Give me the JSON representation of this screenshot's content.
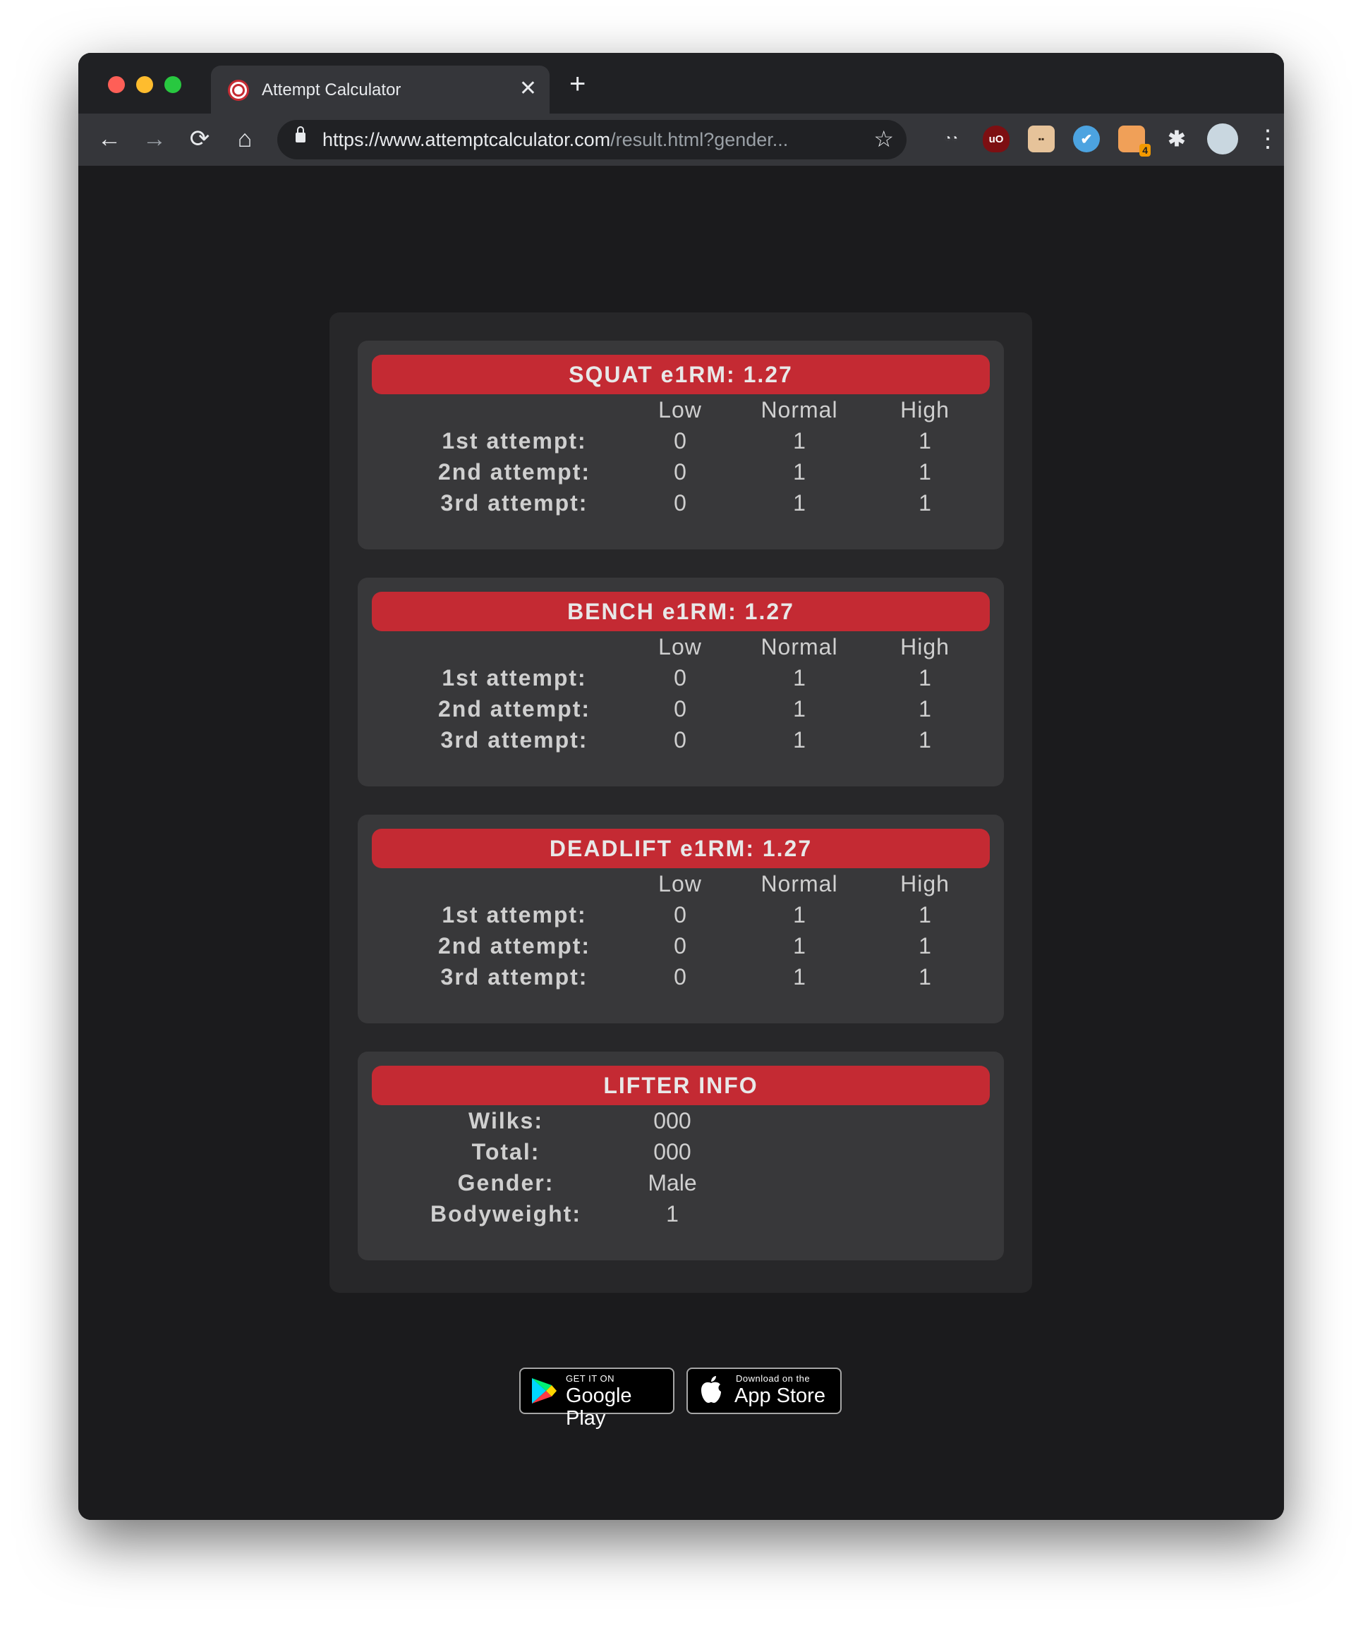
{
  "browser": {
    "tab_title": "Attempt Calculator",
    "tab_close": "✕",
    "new_tab": "+",
    "url_main": "https://www.attemptcalculator.com",
    "url_rest": "/result.html?gender...",
    "back": "←",
    "forward": "→",
    "reload": "⟳",
    "home": "⌂",
    "star": "☆",
    "menu": "⋮",
    "extensions": {
      "ext1": "◔◔",
      "ext2": "uO",
      "ext3": "▪▪",
      "ext4": "✔",
      "ext5_badge": "4",
      "puzzle": "✱"
    }
  },
  "cards": [
    {
      "title": "SQUAT e1RM: 1.27",
      "columns": [
        "Low",
        "Normal",
        "High"
      ],
      "rows": [
        {
          "label": "1st attempt:",
          "values": [
            "0",
            "1",
            "1"
          ]
        },
        {
          "label": "2nd attempt:",
          "values": [
            "0",
            "1",
            "1"
          ]
        },
        {
          "label": "3rd attempt:",
          "values": [
            "0",
            "1",
            "1"
          ]
        }
      ]
    },
    {
      "title": "BENCH e1RM: 1.27",
      "columns": [
        "Low",
        "Normal",
        "High"
      ],
      "rows": [
        {
          "label": "1st attempt:",
          "values": [
            "0",
            "1",
            "1"
          ]
        },
        {
          "label": "2nd attempt:",
          "values": [
            "0",
            "1",
            "1"
          ]
        },
        {
          "label": "3rd attempt:",
          "values": [
            "0",
            "1",
            "1"
          ]
        }
      ]
    },
    {
      "title": "DEADLIFT e1RM: 1.27",
      "columns": [
        "Low",
        "Normal",
        "High"
      ],
      "rows": [
        {
          "label": "1st attempt:",
          "values": [
            "0",
            "1",
            "1"
          ]
        },
        {
          "label": "2nd attempt:",
          "values": [
            "0",
            "1",
            "1"
          ]
        },
        {
          "label": "3rd attempt:",
          "values": [
            "0",
            "1",
            "1"
          ]
        }
      ]
    }
  ],
  "lifter_info": {
    "title": "LIFTER INFO",
    "rows": [
      {
        "label": "Wilks:",
        "value": "000"
      },
      {
        "label": "Total:",
        "value": "000"
      },
      {
        "label": "Gender:",
        "value": "Male"
      },
      {
        "label": "Bodyweight:",
        "value": "1"
      }
    ]
  },
  "stores": {
    "google_small": "GET IT ON",
    "google_big": "Google Play",
    "apple_small": "Download on the",
    "apple_big": "App Store"
  },
  "colors": {
    "accent_red": "#c42a33",
    "page_bg": "#1b1b1d",
    "panel_bg": "#272729",
    "card_bg": "#38383a"
  }
}
